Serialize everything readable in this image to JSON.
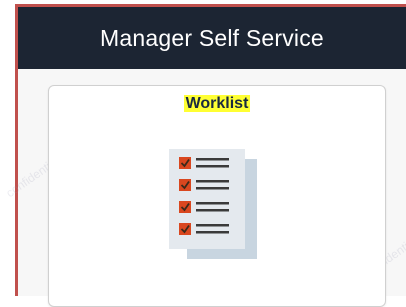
{
  "header": {
    "title": "Manager Self Service",
    "background": "#1c2533"
  },
  "tile": {
    "title": "Worklist",
    "title_highlight": "#ffff33",
    "icon": "checklist-icon"
  },
  "colors": {
    "frame_border": "#c0504d",
    "checkbox": "#d9471f",
    "list_lines": "#3a3a3a",
    "paper": "#e4e9ee",
    "paper_shadow": "#c8d5e0"
  }
}
